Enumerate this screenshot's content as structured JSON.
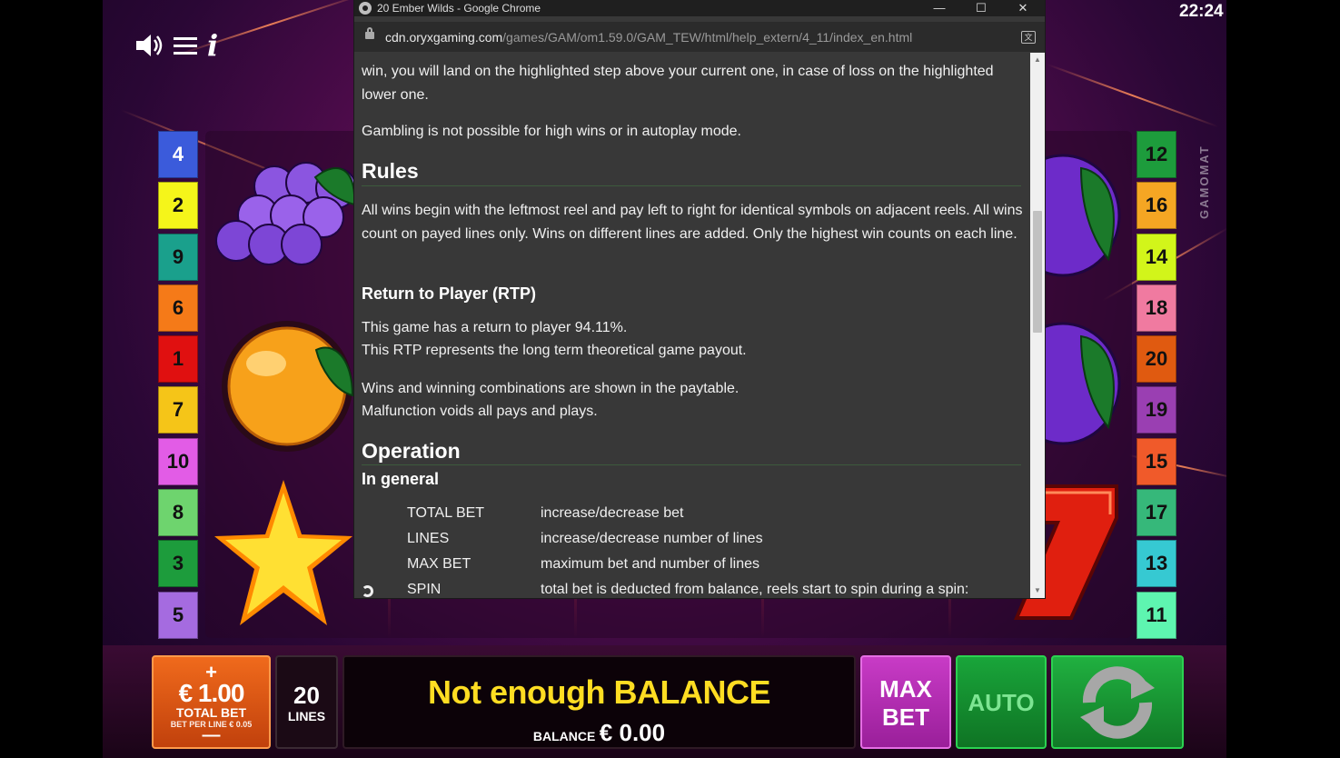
{
  "window": {
    "title": "20 Ember Wilds - Google Chrome",
    "minimize": "—",
    "maximize": "☐",
    "close": "✕"
  },
  "address": {
    "host": "cdn.oryxgaming.com",
    "path": "/games/GAM/om1.59.0/GAM_TEW/html/help_extern/4_11/index_en.html"
  },
  "help": {
    "gamble_tail": "win, you will land on the highlighted step above your current one, in case of loss on the highlighted lower one.",
    "gamble_limit": "Gambling is not possible for high wins or in autoplay mode.",
    "rules_heading": "Rules",
    "rules_text": "All wins begin with the leftmost reel and pay left to right for identical symbols on adjacent reels. All wins count on payed lines only. Wins on different lines are added. Only the highest win counts on each line.",
    "rtp_heading": "Return to Player (RTP)",
    "rtp_line1": "This game has a return to player 94.11%.",
    "rtp_line2": "This RTP represents the long term theoretical game payout.",
    "wins_line1": "Wins and winning combinations are shown in the paytable.",
    "wins_line2": "Malfunction voids all pays and plays.",
    "operation_heading": "Operation",
    "general_heading": "In general",
    "controls": [
      {
        "key": "TOTAL BET",
        "desc": "increase/decrease bet"
      },
      {
        "key": "LINES",
        "desc": "increase/decrease number of lines"
      },
      {
        "key": "MAX BET",
        "desc": "maximum bet and number of lines"
      },
      {
        "key": "SPIN",
        "desc": "total bet is deducted from balance, reels start to spin during a spin:"
      }
    ]
  },
  "game": {
    "clock": "22:24",
    "brand": "GAMOMAT",
    "info_icon": "i",
    "left_lines": [
      "4",
      "2",
      "9",
      "6",
      "1",
      "7",
      "10",
      "8",
      "3",
      "5"
    ],
    "right_lines": [
      "12",
      "16",
      "14",
      "18",
      "20",
      "19",
      "15",
      "17",
      "13",
      "11"
    ],
    "left_colors": [
      "#3b5bdb",
      "#f5f51a",
      "#1aa08c",
      "#f57a18",
      "#e01010",
      "#f5c518",
      "#e25ce6",
      "#6ed46e",
      "#1d9c3c",
      "#a56be0"
    ],
    "right_colors": [
      "#1d9c3c",
      "#f5a623",
      "#d2f51a",
      "#f07aa0",
      "#e05a10",
      "#9a3fb2",
      "#f05a2a",
      "#36b87a",
      "#36c9d2",
      "#5ef5b0"
    ]
  },
  "controls_bar": {
    "bet_plus": "+",
    "bet_amount": "€ 1.00",
    "bet_label": "TOTAL BET",
    "bet_per_line": "BET PER LINE € 0.05",
    "bet_minus": "—",
    "lines_value": "20",
    "lines_label": "LINES",
    "message": "Not enough BALANCE",
    "balance_label": "BALANCE",
    "balance_value": "€ 0.00",
    "maxbet_line1": "MAX",
    "maxbet_line2": "BET",
    "auto_label": "AUTO"
  }
}
